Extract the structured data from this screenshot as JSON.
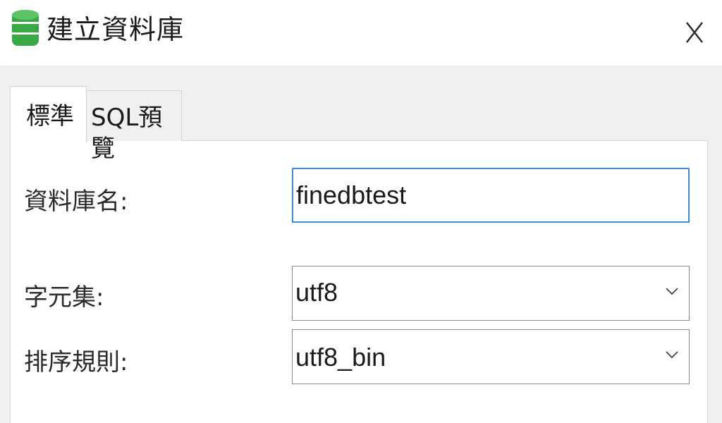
{
  "window": {
    "title": "建立資料庫",
    "icon": "database-icon",
    "close_icon": "close-icon",
    "accent_color": "#3c8fd6",
    "icon_color": "#3aa845"
  },
  "tabs": [
    {
      "label": "標準",
      "active": true
    },
    {
      "label": "SQL預覽",
      "active": false
    }
  ],
  "form": {
    "database_name_label": "資料庫名:",
    "database_name_value": "finedbtest",
    "charset_label": "字元集:",
    "charset_value": "utf8",
    "collation_label": "排序規則:",
    "collation_value": "utf8_bin"
  }
}
